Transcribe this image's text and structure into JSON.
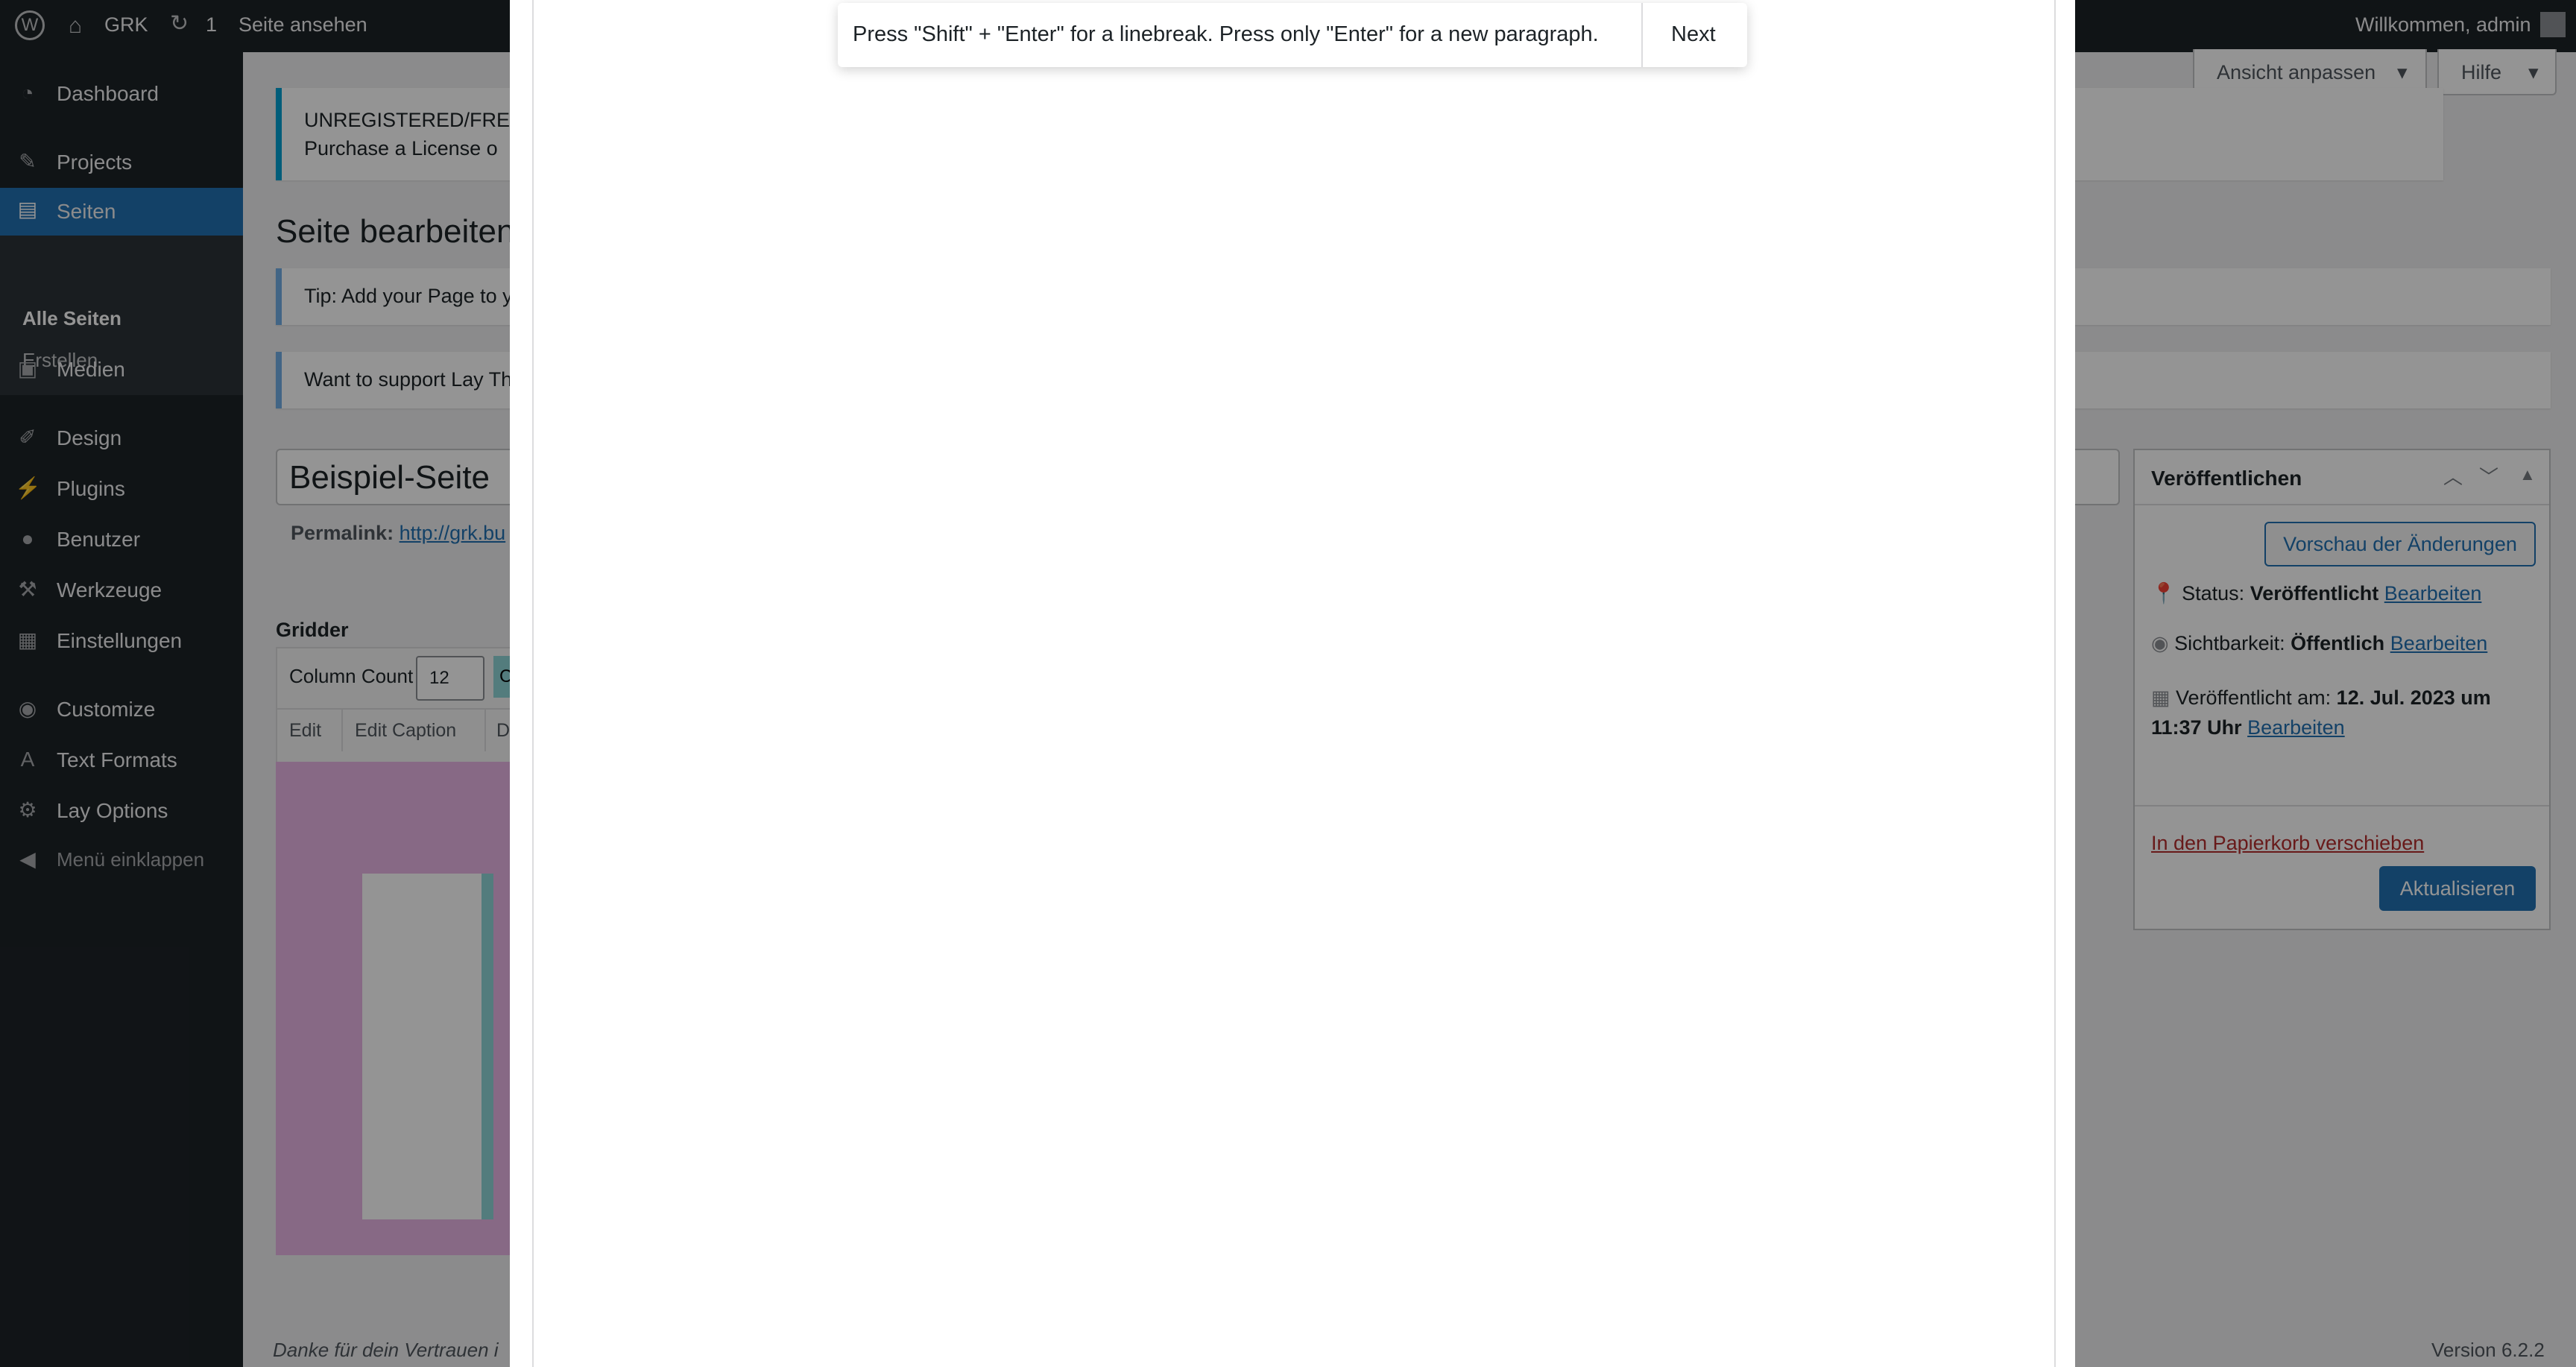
{
  "adminbar": {
    "site_name": "GRK",
    "updates_count": "1",
    "view_page": "Seite ansehen",
    "welcome": "Willkommen, admin"
  },
  "screen_options": {
    "view": "Ansicht anpassen",
    "help": "Hilfe"
  },
  "sidebar": {
    "items": [
      {
        "label": "Dashboard",
        "icon": "dashboard-icon"
      },
      {
        "label": "Projects",
        "icon": "pin-icon"
      },
      {
        "label": "Seiten",
        "icon": "pages-icon"
      },
      {
        "label": "Medien",
        "icon": "media-icon"
      },
      {
        "label": "Design",
        "icon": "brush-icon"
      },
      {
        "label": "Plugins",
        "icon": "plugin-icon"
      },
      {
        "label": "Benutzer",
        "icon": "user-icon"
      },
      {
        "label": "Werkzeuge",
        "icon": "wrench-icon"
      },
      {
        "label": "Einstellungen",
        "icon": "settings-icon"
      },
      {
        "label": "Customize",
        "icon": "eye-icon"
      },
      {
        "label": "Text Formats",
        "icon": "text-icon"
      },
      {
        "label": "Lay Options",
        "icon": "gear-icon"
      },
      {
        "label": "Menü einklappen",
        "icon": "collapse-icon"
      }
    ],
    "submenu": [
      "Alle Seiten",
      "Erstellen"
    ]
  },
  "notices": {
    "license_line1": "UNREGISTERED/FREE",
    "license_line2": "Purchase a License o",
    "tip": "Tip: Add your Page to y",
    "support": "Want to support Lay Th"
  },
  "editor": {
    "heading": "Seite bearbeiten",
    "title_value": "Beispiel-Seite",
    "permalink_label": "Permalink:",
    "permalink_url": "http://grk.bu",
    "gridder_label": "Gridder",
    "column_count_label": "Column Count",
    "column_count_value": "12",
    "column_btn": "C",
    "edit": "Edit",
    "edit_caption": "Edit Caption",
    "delete": "Dele"
  },
  "publish": {
    "title": "Veröffentlichen",
    "preview": "Vorschau der Änderungen",
    "status_label": "Status:",
    "status_value": "Veröffentlicht",
    "edit_link": "Bearbeiten",
    "visibility_label": "Sichtbarkeit:",
    "visibility_value": "Öffentlich",
    "published_label": "Veröffentlicht am:",
    "published_value_1": "12. Jul. 2023 um",
    "published_value_2": "11:37 Uhr",
    "trash": "In den Papierkorb verschieben",
    "update": "Aktualisieren"
  },
  "footer": {
    "thanks": "Danke für dein Vertrauen i",
    "version": "Version 6.2.2"
  },
  "tooltip": {
    "text": "Press \"Shift\" + \"Enter\" for a linebreak. Press only \"Enter\" for a new paragraph.",
    "next": "Next"
  }
}
